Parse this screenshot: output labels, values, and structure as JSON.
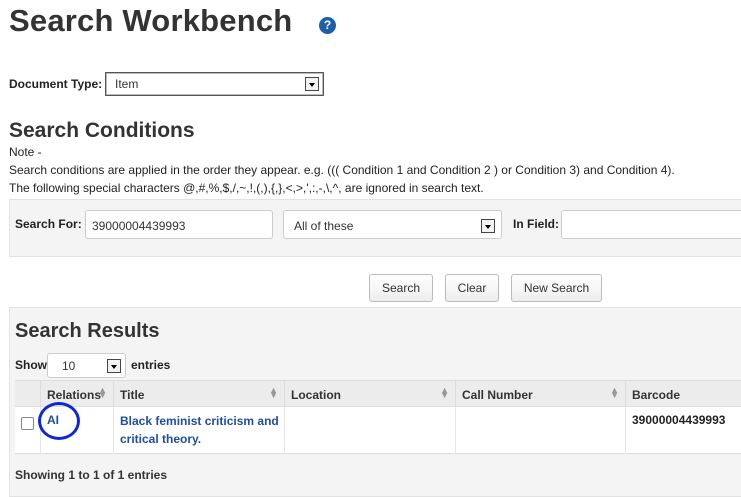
{
  "page": {
    "title": "Search Workbench",
    "help_glyph": "?"
  },
  "document_type": {
    "label": "Document Type:",
    "value": "Item"
  },
  "conditions": {
    "heading": "Search Conditions",
    "note_label": "Note -",
    "note_line1": "Search conditions are applied in the order they appear. e.g. ((( Condition 1 and Condition 2 ) or Condition 3) and Condition 4).",
    "note_line2": "The following special characters @,#,%,$,/,~,!,(,),{,},<,>,',:,-,\\,^, are ignored in search text.",
    "search_for_label": "Search For:",
    "search_for_value": "39000004439993",
    "operator_value": "All of these",
    "in_field_label": "In Field:",
    "in_field_value": ""
  },
  "actions": {
    "search": "Search",
    "clear": "Clear",
    "new_search": "New Search"
  },
  "results": {
    "heading": "Search Results",
    "show_label": "Show",
    "page_length": "10",
    "entries_label": "entries",
    "columns": [
      "Relations",
      "Title",
      "Location",
      "Call Number",
      "Barcode"
    ],
    "rows": [
      {
        "relations": "AI",
        "title_line1": "Black feminist criticism and",
        "title_line2": "critical theory.",
        "location": "",
        "call_number": "",
        "barcode": "39000004439993"
      }
    ],
    "footer": "Showing 1 to 1 of 1 entries"
  },
  "colors": {
    "link": "#1f4ea3",
    "highlight_circle": "#0d27d8",
    "help_icon": "#1f5ea8"
  }
}
